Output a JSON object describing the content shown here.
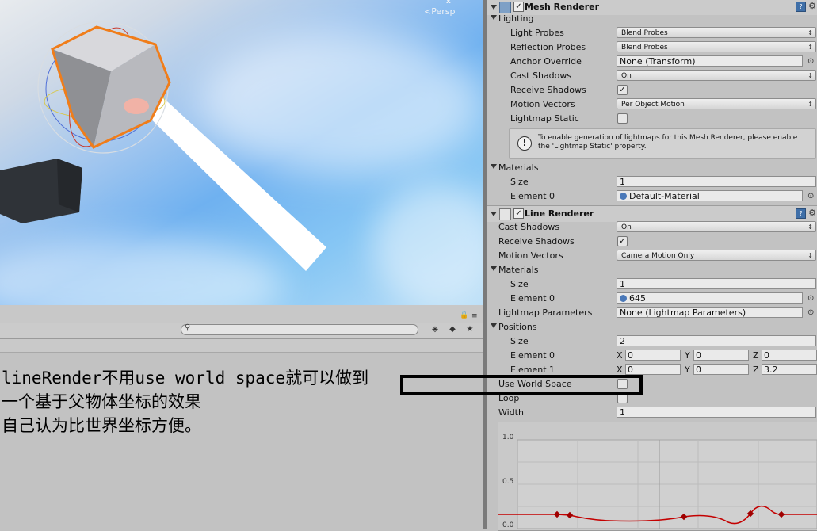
{
  "scene": {
    "view_label": "Persp",
    "axis_label": "x"
  },
  "hierarchy": {
    "search_placeholder": ""
  },
  "annotation": {
    "lines": [
      "lineRender不用use world space就可以做到",
      "一个基于父物体坐标的效果",
      "自己认为比世界坐标方便。"
    ]
  },
  "mesh_renderer": {
    "title": "Mesh Renderer",
    "lighting_label": "Lighting",
    "light_probes_label": "Light Probes",
    "light_probes_value": "Blend Probes",
    "reflection_probes_label": "Reflection Probes",
    "reflection_probes_value": "Blend Probes",
    "anchor_override_label": "Anchor Override",
    "anchor_override_value": "None (Transform)",
    "cast_shadows_label": "Cast Shadows",
    "cast_shadows_value": "On",
    "receive_shadows_label": "Receive Shadows",
    "motion_vectors_label": "Motion Vectors",
    "motion_vectors_value": "Per Object Motion",
    "lightmap_static_label": "Lightmap Static",
    "help_text": "To enable generation of lightmaps for this Mesh Renderer, please enable the 'Lightmap Static' property.",
    "materials_label": "Materials",
    "size_label": "Size",
    "size_value": "1",
    "element0_label": "Element 0",
    "element0_value": "Default-Material"
  },
  "line_renderer": {
    "title": "Line Renderer",
    "cast_shadows_label": "Cast Shadows",
    "cast_shadows_value": "On",
    "receive_shadows_label": "Receive Shadows",
    "motion_vectors_label": "Motion Vectors",
    "motion_vectors_value": "Camera Motion Only",
    "materials_label": "Materials",
    "size_label": "Size",
    "size_value": "1",
    "element0_label": "Element 0",
    "element0_value": "645",
    "lightmap_params_label": "Lightmap Parameters",
    "lightmap_params_value": "None (Lightmap Parameters)",
    "positions_label": "Positions",
    "pos_size_label": "Size",
    "pos_size_value": "2",
    "pos_element0_label": "Element 0",
    "pos_element1_label": "Element 1",
    "axis_x": "X",
    "axis_y": "Y",
    "axis_z": "Z",
    "e0": {
      "x": "0",
      "y": "0",
      "z": "0"
    },
    "e1": {
      "x": "0",
      "y": "0",
      "z": "3.2"
    },
    "use_world_space_label": "Use World Space",
    "loop_label": "Loop",
    "width_label": "Width",
    "width_value": "1"
  },
  "width_curve": {
    "y_ticks": [
      "1.0",
      "0.5",
      "0.0"
    ]
  }
}
